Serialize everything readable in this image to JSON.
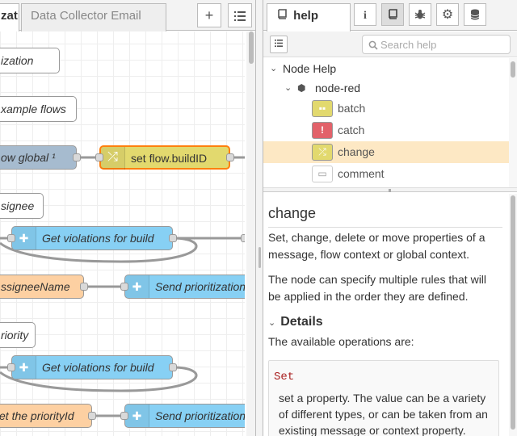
{
  "workspace": {
    "tabs": [
      {
        "label": "zati"
      },
      {
        "label": "Data Collector Email"
      }
    ],
    "add_icon": "plus-icon",
    "list_icon": "list-icon",
    "nodes": {
      "comment_prioritization": "ization",
      "comment_example_flows": "xample flows",
      "flow_global": "ow global ¹",
      "change_build": "set flow.buildID",
      "comment_assignee": "signee",
      "get_violations_1": "Get violations for build",
      "assignee_name": "ssigneeName",
      "send_prioritization_1": "Send prioritization",
      "comment_priority": "riority",
      "get_violations_2": "Get violations for build",
      "set_priority": "et the priorityId",
      "send_prioritization_2": "Send prioritization"
    }
  },
  "sidebar": {
    "tab_help": "help",
    "icons": [
      "info-icon",
      "book-icon",
      "bug-icon",
      "gear-icon",
      "database-icon"
    ],
    "search_placeholder": "Search help",
    "tree": {
      "root": "Node Help",
      "module": "node-red",
      "items": [
        {
          "label": "batch",
          "color": "#e2d96e"
        },
        {
          "label": "catch",
          "color": "#e2626a"
        },
        {
          "label": "change",
          "color": "#e2d96e",
          "selected": true
        },
        {
          "label": "comment",
          "color": "#ffffff"
        }
      ]
    },
    "content": {
      "title": "change",
      "p1": "Set, change, delete or move properties of a message, flow context or global context.",
      "p2": "The node can specify multiple rules that will be applied in the order they are defined.",
      "details_heading": "Details",
      "details_intro": "The available operations are:",
      "set_key": "Set",
      "set_desc": "set a property. The value can be a variety of different types, or can be taken from an existing message or context property."
    }
  },
  "colors": {
    "subflow": "#87d0f4",
    "link": "#a6bbcf",
    "function_orange": "#fdd0a2",
    "change_yellow": "#e2d96e",
    "selection": "#ff7f0e"
  }
}
